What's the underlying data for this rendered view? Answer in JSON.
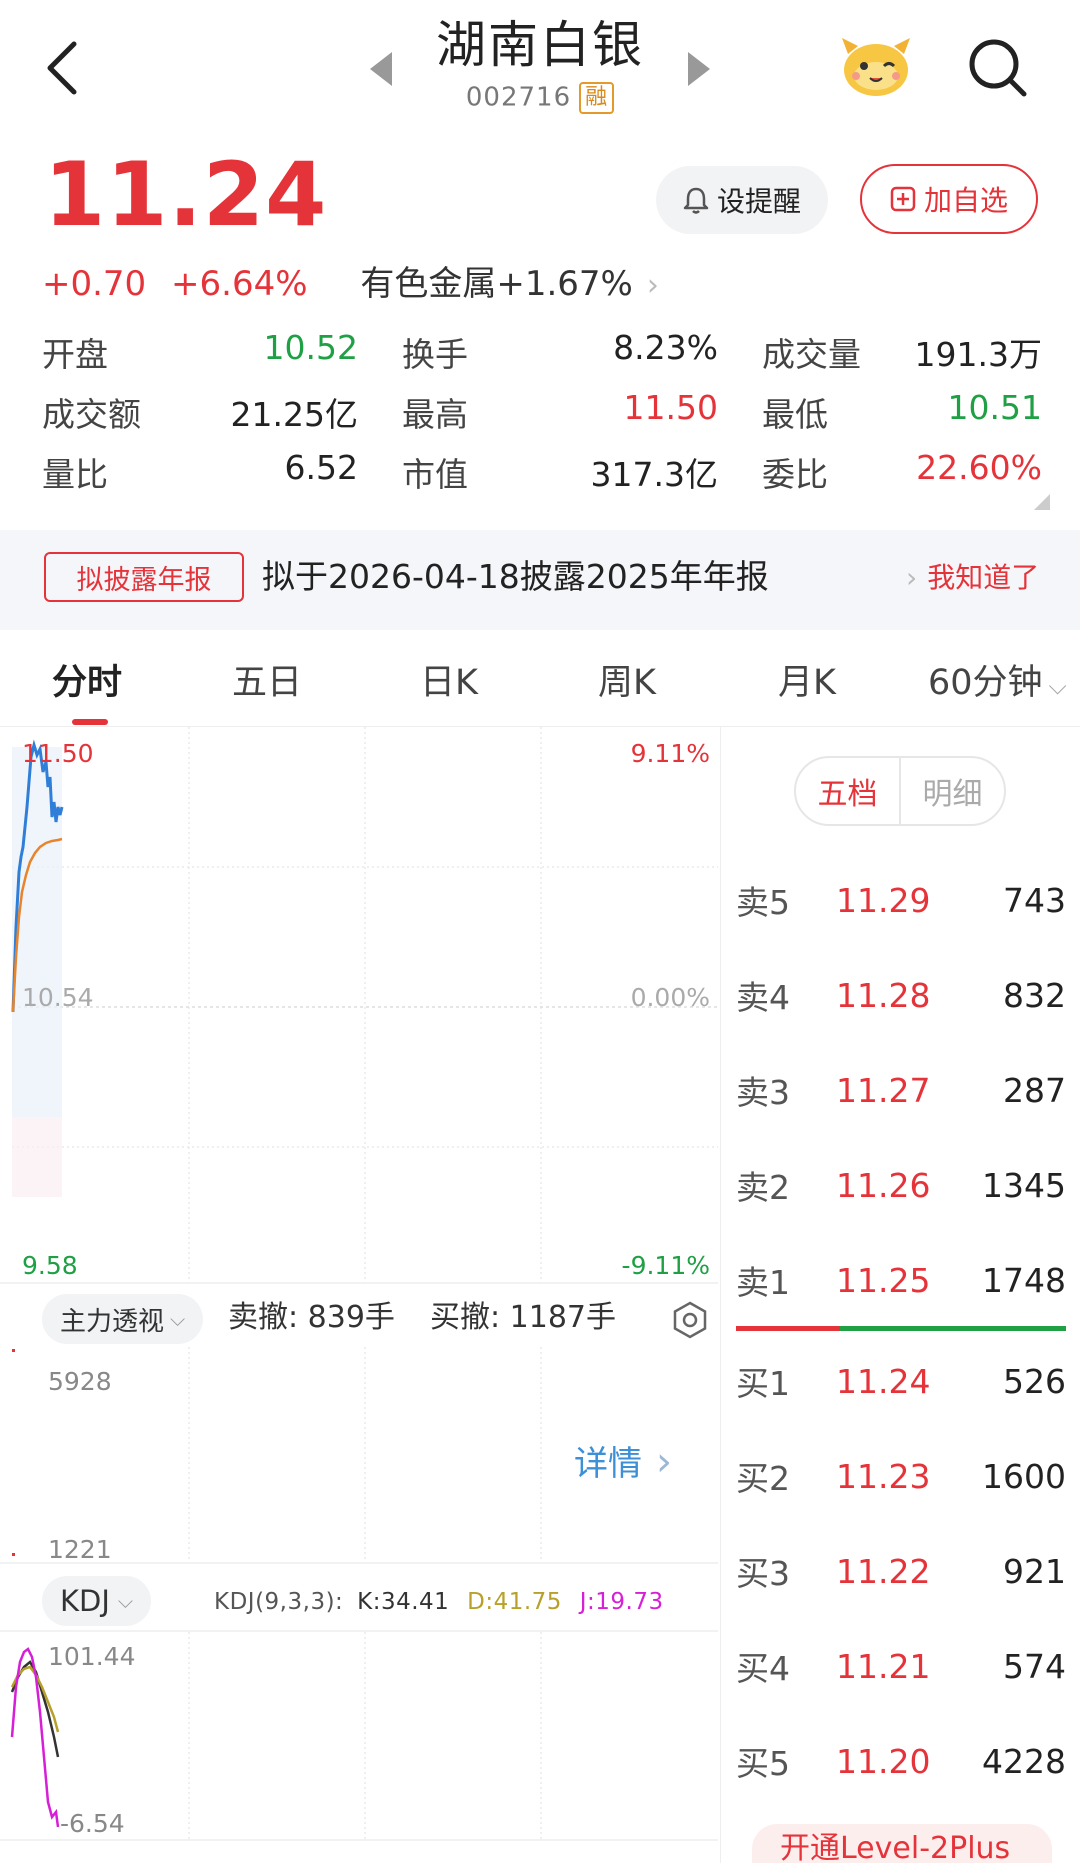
{
  "header": {
    "title": "湖南白银",
    "code": "002716",
    "margin_badge": "融"
  },
  "quote": {
    "price": "11.24",
    "change": "+0.70",
    "change_pct": "+6.64%",
    "sector": "有色金属",
    "sector_pct": "+1.67%",
    "alert_label": "设提醒",
    "add_label": "加自选"
  },
  "stats": {
    "row1": [
      {
        "label": "开盘",
        "value": "10.52",
        "color": "green"
      },
      {
        "label": "换手",
        "value": "8.23%",
        "color": ""
      },
      {
        "label": "成交量",
        "value": "191.3万",
        "color": ""
      }
    ],
    "row2": [
      {
        "label": "成交额",
        "value": "21.25亿",
        "color": ""
      },
      {
        "label": "最高",
        "value": "11.50",
        "color": "red"
      },
      {
        "label": "最低",
        "value": "10.51",
        "color": "green"
      }
    ],
    "row3": [
      {
        "label": "量比",
        "value": "6.52",
        "color": ""
      },
      {
        "label": "市值",
        "value": "317.3亿",
        "color": ""
      },
      {
        "label": "委比",
        "value": "22.60%",
        "color": "red"
      }
    ]
  },
  "notice": {
    "tag": "拟披露年报",
    "text": "拟于2026-04-18披露2025年年报",
    "dismiss": "我知道了"
  },
  "tabs": [
    {
      "label": "分时"
    },
    {
      "label": "五日"
    },
    {
      "label": "日K"
    },
    {
      "label": "周K"
    },
    {
      "label": "月K"
    },
    {
      "label": "60分钟"
    }
  ],
  "chart": {
    "price_high": "11.50",
    "price_mid": "10.54",
    "price_low": "9.58",
    "pct_high": "9.11%",
    "pct_mid": "0.00%",
    "pct_low": "-9.11%",
    "colors": {
      "price_line": "#2f7fd8",
      "avg_line": "#e8842c",
      "up": "#e5333a",
      "down": "#1fa044"
    }
  },
  "indicator_bar": {
    "selector": "主力透视",
    "sell_cancel": "卖撤: 839手",
    "buy_cancel": "买撤: 1187手"
  },
  "volume": {
    "top": "5928",
    "bottom": "1221",
    "detail_label": "详情"
  },
  "kdj": {
    "selector": "KDJ",
    "params": "KDJ(9,3,3):",
    "k": "K:34.41",
    "d": "D:41.75",
    "j": "J:19.73",
    "top": "101.44",
    "bottom": "-6.54",
    "colors": {
      "k": "#333333",
      "d": "#b8a12a",
      "j": "#d61fd6"
    }
  },
  "depth": {
    "tab_five": "五档",
    "tab_detail": "明细",
    "asks": [
      {
        "label": "卖5",
        "price": "11.29",
        "vol": "743"
      },
      {
        "label": "卖4",
        "price": "11.28",
        "vol": "832"
      },
      {
        "label": "卖3",
        "price": "11.27",
        "vol": "287"
      },
      {
        "label": "卖2",
        "price": "11.26",
        "vol": "1345"
      },
      {
        "label": "卖1",
        "price": "11.25",
        "vol": "1748"
      }
    ],
    "bids": [
      {
        "label": "买1",
        "price": "11.24",
        "vol": "526"
      },
      {
        "label": "买2",
        "price": "11.23",
        "vol": "1600"
      },
      {
        "label": "买3",
        "price": "11.22",
        "vol": "921"
      },
      {
        "label": "买4",
        "price": "11.21",
        "vol": "574"
      },
      {
        "label": "买5",
        "price": "11.20",
        "vol": "4228"
      }
    ],
    "level2_label": "开通Level-2Plus"
  }
}
